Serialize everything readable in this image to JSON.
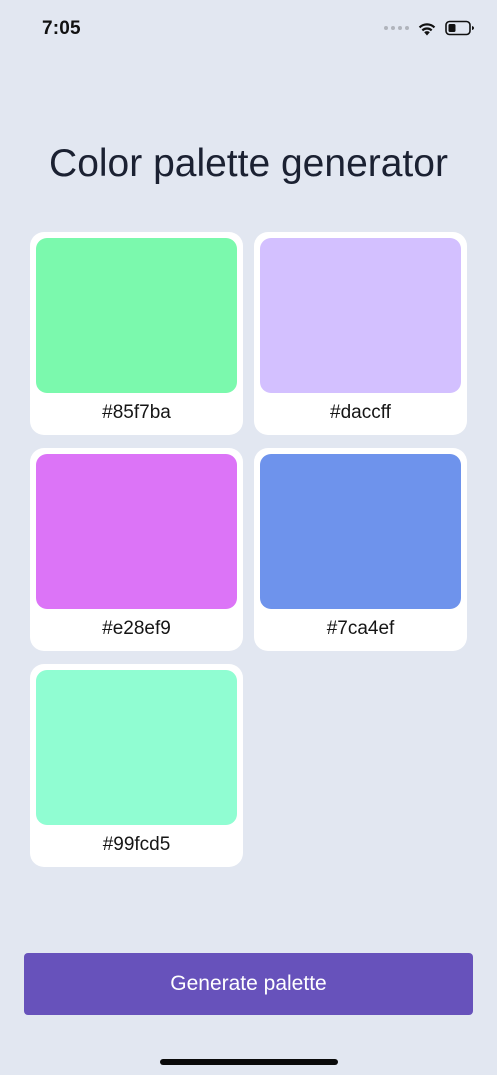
{
  "status_bar": {
    "time": "7:05",
    "icons": [
      "signal-icon",
      "wifi-icon",
      "battery-icon"
    ]
  },
  "title": "Color palette generator",
  "palette": [
    {
      "hex": "#85f7ba",
      "color": "#7bf9ad"
    },
    {
      "hex": "#daccff",
      "color": "#d3c0ff"
    },
    {
      "hex": "#e28ef9",
      "color": "#dc74f7"
    },
    {
      "hex": "#7ca4ef",
      "color": "#6e93ec"
    },
    {
      "hex": "#99fcd5",
      "color": "#90fdd2"
    }
  ],
  "generate_button": {
    "label": "Generate palette",
    "color": "#6752bb"
  },
  "colors": {
    "background": "#e2e7f1",
    "card": "#ffffff"
  }
}
